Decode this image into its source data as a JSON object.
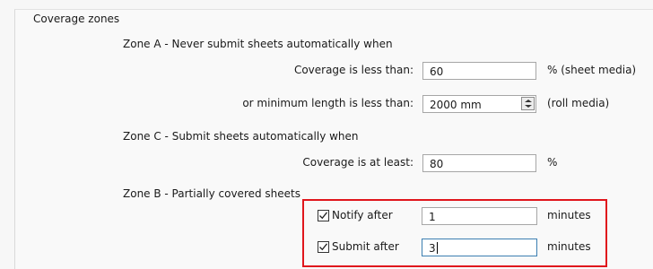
{
  "coverage_zones": {
    "section_title": "Coverage zones",
    "zone_a": {
      "title": "Zone A - Never submit sheets automatically when",
      "coverage_label": "Coverage is less than:",
      "coverage_value": "60",
      "coverage_unit": "% (sheet media)",
      "min_length_label": "or minimum length is less than:",
      "min_length_value": "2000 mm",
      "min_length_unit": "(roll media)"
    },
    "zone_c": {
      "title": "Zone C - Submit sheets automatically when",
      "coverage_label": "Coverage is at least:",
      "coverage_value": "80",
      "coverage_unit": "%"
    },
    "zone_b": {
      "title": "Zone B - Partially covered sheets",
      "notify_label": "Notify after",
      "notify_checked": true,
      "notify_value": "1",
      "notify_unit": "minutes",
      "submit_label": "Submit after",
      "submit_checked": true,
      "submit_value": "3",
      "submit_unit": "minutes"
    }
  },
  "colors": {
    "highlight_border": "#e0161c",
    "focused_input_border": "#3c7fb1"
  },
  "icons": {
    "spinner": "spinner-arrows-icon",
    "checkbox": "checkmark-icon"
  }
}
